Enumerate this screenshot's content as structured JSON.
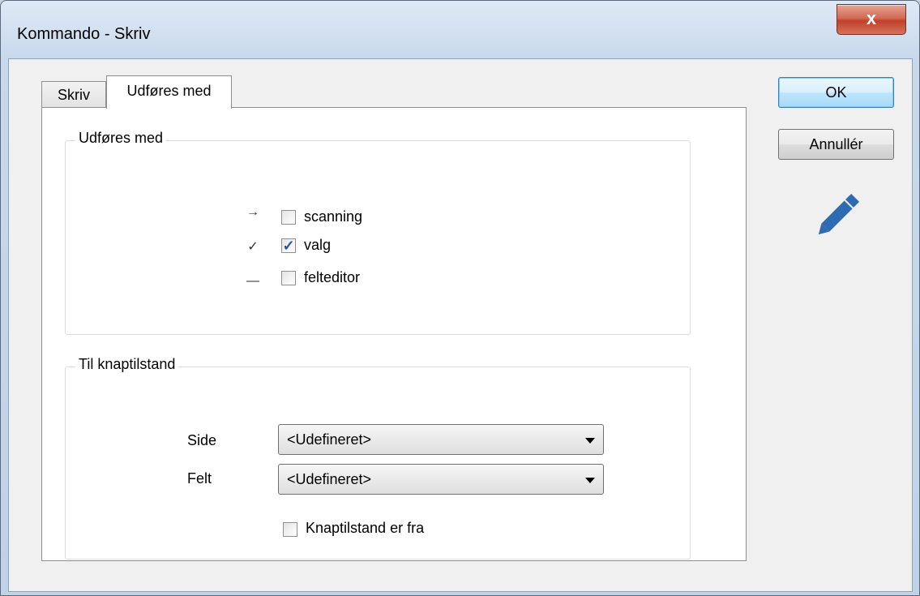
{
  "window": {
    "title": "Kommando - Skriv",
    "close_label": "x"
  },
  "tabs": [
    {
      "label": "Skriv",
      "active": false
    },
    {
      "label": "Udføres med",
      "active": true
    }
  ],
  "execute_group": {
    "title": "Udføres med",
    "options": [
      {
        "marker": "→",
        "label": "scanning",
        "checked": false
      },
      {
        "marker": "✓",
        "label": "valg",
        "checked": true
      },
      {
        "marker": "—",
        "label": "felteditor",
        "checked": false
      }
    ]
  },
  "button_state_group": {
    "title": "Til knaptilstand",
    "side_label": "Side",
    "side_value": "<Udefineret>",
    "field_label": "Felt",
    "field_value": "<Udefineret>",
    "off_checkbox_label": "Knaptilstand er fra",
    "off_checked": false
  },
  "buttons": {
    "ok": "OK",
    "cancel": "Annullér"
  },
  "colors": {
    "pencil": "#2f6bb3",
    "check": "#2a4fa8"
  },
  "icons": [
    "close-icon",
    "pencil-icon",
    "arrow-right-icon",
    "checkmark-icon",
    "dash-icon",
    "chevron-down-icon"
  ]
}
